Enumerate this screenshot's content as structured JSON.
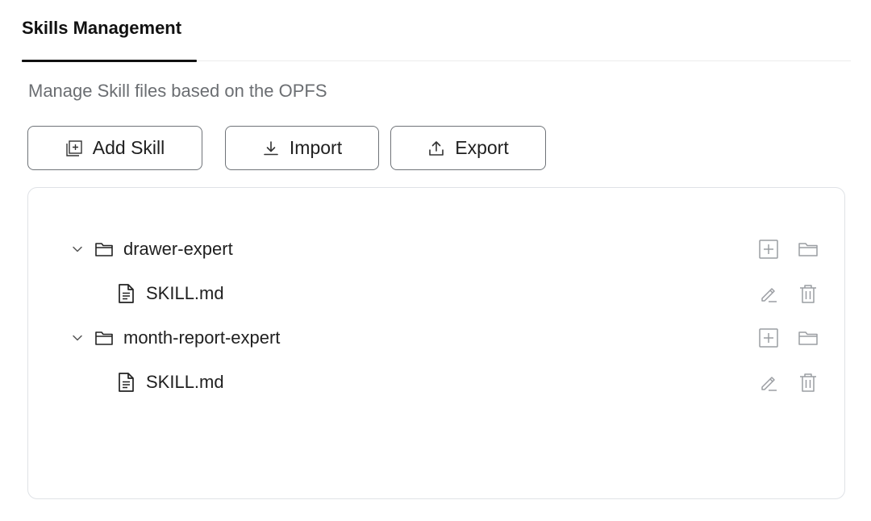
{
  "header": {
    "tab_label": "Skills Management"
  },
  "subtitle": "Manage Skill files based on the OPFS",
  "toolbar": {
    "add_label": "Add Skill",
    "import_label": "Import",
    "export_label": "Export"
  },
  "tree": {
    "folders": [
      {
        "name": "drawer-expert",
        "expanded": true,
        "files": [
          {
            "name": "SKILL.md"
          }
        ]
      },
      {
        "name": "month-report-expert",
        "expanded": true,
        "files": [
          {
            "name": "SKILL.md"
          }
        ]
      }
    ]
  },
  "colors": {
    "text": "#1f1f1f",
    "muted": "#6b6e72",
    "icon_muted": "#9a9da2",
    "border": "#dfe2e6",
    "button_border": "#6f7378"
  },
  "icons": {
    "add": "plus-square-icon",
    "import": "download-icon",
    "export": "upload-icon",
    "folder": "folder-icon",
    "file": "file-text-icon",
    "caret": "chevron-down-icon",
    "new_file": "plus-square-icon",
    "new_folder": "folder-icon",
    "edit": "pencil-icon",
    "delete": "trash-icon"
  }
}
